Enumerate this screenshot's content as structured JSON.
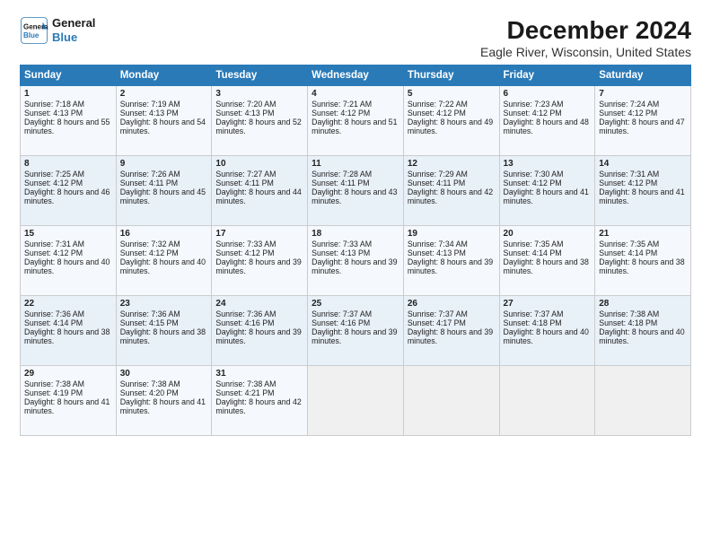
{
  "logo": {
    "line1": "General",
    "line2": "Blue"
  },
  "title": "December 2024",
  "subtitle": "Eagle River, Wisconsin, United States",
  "days_header": [
    "Sunday",
    "Monday",
    "Tuesday",
    "Wednesday",
    "Thursday",
    "Friday",
    "Saturday"
  ],
  "weeks": [
    [
      {
        "day": "1",
        "rise": "Sunrise: 7:18 AM",
        "set": "Sunset: 4:13 PM",
        "daylight": "Daylight: 8 hours and 55 minutes."
      },
      {
        "day": "2",
        "rise": "Sunrise: 7:19 AM",
        "set": "Sunset: 4:13 PM",
        "daylight": "Daylight: 8 hours and 54 minutes."
      },
      {
        "day": "3",
        "rise": "Sunrise: 7:20 AM",
        "set": "Sunset: 4:13 PM",
        "daylight": "Daylight: 8 hours and 52 minutes."
      },
      {
        "day": "4",
        "rise": "Sunrise: 7:21 AM",
        "set": "Sunset: 4:12 PM",
        "daylight": "Daylight: 8 hours and 51 minutes."
      },
      {
        "day": "5",
        "rise": "Sunrise: 7:22 AM",
        "set": "Sunset: 4:12 PM",
        "daylight": "Daylight: 8 hours and 49 minutes."
      },
      {
        "day": "6",
        "rise": "Sunrise: 7:23 AM",
        "set": "Sunset: 4:12 PM",
        "daylight": "Daylight: 8 hours and 48 minutes."
      },
      {
        "day": "7",
        "rise": "Sunrise: 7:24 AM",
        "set": "Sunset: 4:12 PM",
        "daylight": "Daylight: 8 hours and 47 minutes."
      }
    ],
    [
      {
        "day": "8",
        "rise": "Sunrise: 7:25 AM",
        "set": "Sunset: 4:12 PM",
        "daylight": "Daylight: 8 hours and 46 minutes."
      },
      {
        "day": "9",
        "rise": "Sunrise: 7:26 AM",
        "set": "Sunset: 4:11 PM",
        "daylight": "Daylight: 8 hours and 45 minutes."
      },
      {
        "day": "10",
        "rise": "Sunrise: 7:27 AM",
        "set": "Sunset: 4:11 PM",
        "daylight": "Daylight: 8 hours and 44 minutes."
      },
      {
        "day": "11",
        "rise": "Sunrise: 7:28 AM",
        "set": "Sunset: 4:11 PM",
        "daylight": "Daylight: 8 hours and 43 minutes."
      },
      {
        "day": "12",
        "rise": "Sunrise: 7:29 AM",
        "set": "Sunset: 4:11 PM",
        "daylight": "Daylight: 8 hours and 42 minutes."
      },
      {
        "day": "13",
        "rise": "Sunrise: 7:30 AM",
        "set": "Sunset: 4:12 PM",
        "daylight": "Daylight: 8 hours and 41 minutes."
      },
      {
        "day": "14",
        "rise": "Sunrise: 7:31 AM",
        "set": "Sunset: 4:12 PM",
        "daylight": "Daylight: 8 hours and 41 minutes."
      }
    ],
    [
      {
        "day": "15",
        "rise": "Sunrise: 7:31 AM",
        "set": "Sunset: 4:12 PM",
        "daylight": "Daylight: 8 hours and 40 minutes."
      },
      {
        "day": "16",
        "rise": "Sunrise: 7:32 AM",
        "set": "Sunset: 4:12 PM",
        "daylight": "Daylight: 8 hours and 40 minutes."
      },
      {
        "day": "17",
        "rise": "Sunrise: 7:33 AM",
        "set": "Sunset: 4:12 PM",
        "daylight": "Daylight: 8 hours and 39 minutes."
      },
      {
        "day": "18",
        "rise": "Sunrise: 7:33 AM",
        "set": "Sunset: 4:13 PM",
        "daylight": "Daylight: 8 hours and 39 minutes."
      },
      {
        "day": "19",
        "rise": "Sunrise: 7:34 AM",
        "set": "Sunset: 4:13 PM",
        "daylight": "Daylight: 8 hours and 39 minutes."
      },
      {
        "day": "20",
        "rise": "Sunrise: 7:35 AM",
        "set": "Sunset: 4:14 PM",
        "daylight": "Daylight: 8 hours and 38 minutes."
      },
      {
        "day": "21",
        "rise": "Sunrise: 7:35 AM",
        "set": "Sunset: 4:14 PM",
        "daylight": "Daylight: 8 hours and 38 minutes."
      }
    ],
    [
      {
        "day": "22",
        "rise": "Sunrise: 7:36 AM",
        "set": "Sunset: 4:14 PM",
        "daylight": "Daylight: 8 hours and 38 minutes."
      },
      {
        "day": "23",
        "rise": "Sunrise: 7:36 AM",
        "set": "Sunset: 4:15 PM",
        "daylight": "Daylight: 8 hours and 38 minutes."
      },
      {
        "day": "24",
        "rise": "Sunrise: 7:36 AM",
        "set": "Sunset: 4:16 PM",
        "daylight": "Daylight: 8 hours and 39 minutes."
      },
      {
        "day": "25",
        "rise": "Sunrise: 7:37 AM",
        "set": "Sunset: 4:16 PM",
        "daylight": "Daylight: 8 hours and 39 minutes."
      },
      {
        "day": "26",
        "rise": "Sunrise: 7:37 AM",
        "set": "Sunset: 4:17 PM",
        "daylight": "Daylight: 8 hours and 39 minutes."
      },
      {
        "day": "27",
        "rise": "Sunrise: 7:37 AM",
        "set": "Sunset: 4:18 PM",
        "daylight": "Daylight: 8 hours and 40 minutes."
      },
      {
        "day": "28",
        "rise": "Sunrise: 7:38 AM",
        "set": "Sunset: 4:18 PM",
        "daylight": "Daylight: 8 hours and 40 minutes."
      }
    ],
    [
      {
        "day": "29",
        "rise": "Sunrise: 7:38 AM",
        "set": "Sunset: 4:19 PM",
        "daylight": "Daylight: 8 hours and 41 minutes."
      },
      {
        "day": "30",
        "rise": "Sunrise: 7:38 AM",
        "set": "Sunset: 4:20 PM",
        "daylight": "Daylight: 8 hours and 41 minutes."
      },
      {
        "day": "31",
        "rise": "Sunrise: 7:38 AM",
        "set": "Sunset: 4:21 PM",
        "daylight": "Daylight: 8 hours and 42 minutes."
      },
      null,
      null,
      null,
      null
    ]
  ]
}
